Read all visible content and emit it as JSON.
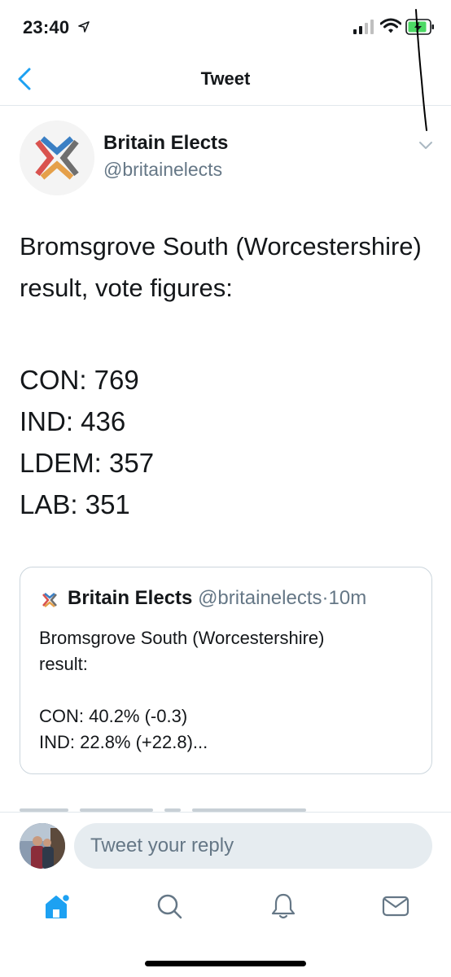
{
  "status": {
    "time": "23:40"
  },
  "nav": {
    "title": "Tweet"
  },
  "tweet": {
    "author_name": "Britain Elects",
    "author_handle": "@britainelects",
    "text": "Bromsgrove South (Worcestershire) result, vote figures:",
    "results": [
      "CON: 769",
      "IND: 436",
      "LDEM: 357",
      "LAB: 351"
    ]
  },
  "quote": {
    "author_name": "Britain Elects",
    "author_handle": "@britainelects",
    "separator": "·",
    "time": "10m",
    "text_line1": "Bromsgrove South (Worcestershire)",
    "text_line2": "result:",
    "text_line3": "CON: 40.2% (-0.3)",
    "text_line4": "IND: 22.8% (+22.8)..."
  },
  "reply": {
    "placeholder": "Tweet your reply"
  },
  "tabs": [
    {
      "icon": "home-icon",
      "active": true
    },
    {
      "icon": "search-icon",
      "active": false
    },
    {
      "icon": "notifications-icon",
      "active": false
    },
    {
      "icon": "messages-icon",
      "active": false
    }
  ],
  "colors": {
    "accent": "#1da1f2",
    "text": "#14171a",
    "secondary": "#657786",
    "divider": "#e1e8ed",
    "logo_red": "#d9534f",
    "logo_blue": "#3a7fc4",
    "logo_orange": "#e5a04a",
    "logo_gray": "#6f6f6f"
  }
}
